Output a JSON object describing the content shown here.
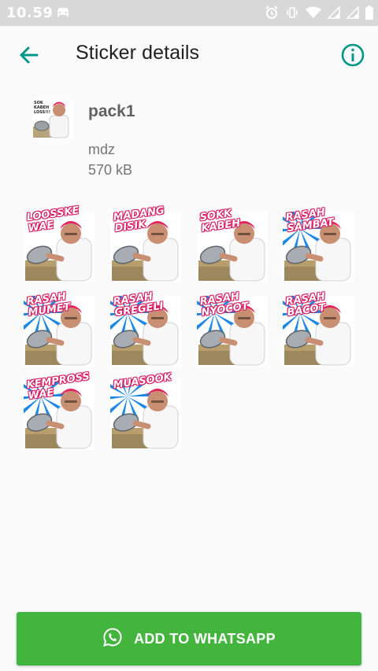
{
  "status": {
    "time": "10.59"
  },
  "header": {
    "title": "Sticker details"
  },
  "pack": {
    "icon_caption": "SOK\nKABEH\nLOSS!!!",
    "name": "pack1",
    "author": "mdz",
    "size": "570 kB"
  },
  "stickers": [
    {
      "caption": "LOOSSKE\nWAE"
    },
    {
      "caption": "MADANG\nDISIK"
    },
    {
      "caption": "SOKK\nKABEH"
    },
    {
      "caption": "RASAH\nSAMBAT"
    },
    {
      "caption": "RASAH\nMUMET"
    },
    {
      "caption": "RASAH\nGREGELI"
    },
    {
      "caption": "RASAH\nNYOCOT"
    },
    {
      "caption": "RASAH\nBACOT"
    },
    {
      "caption": "KEMPROSS\nWAE"
    },
    {
      "caption": "MUASOOK"
    }
  ],
  "actions": {
    "add_label": "ADD TO WHATSAPP"
  },
  "colors": {
    "accent": "#009688",
    "button": "#43b53f",
    "sticker_text": "#e91e63",
    "burst": "#1e88e5"
  }
}
